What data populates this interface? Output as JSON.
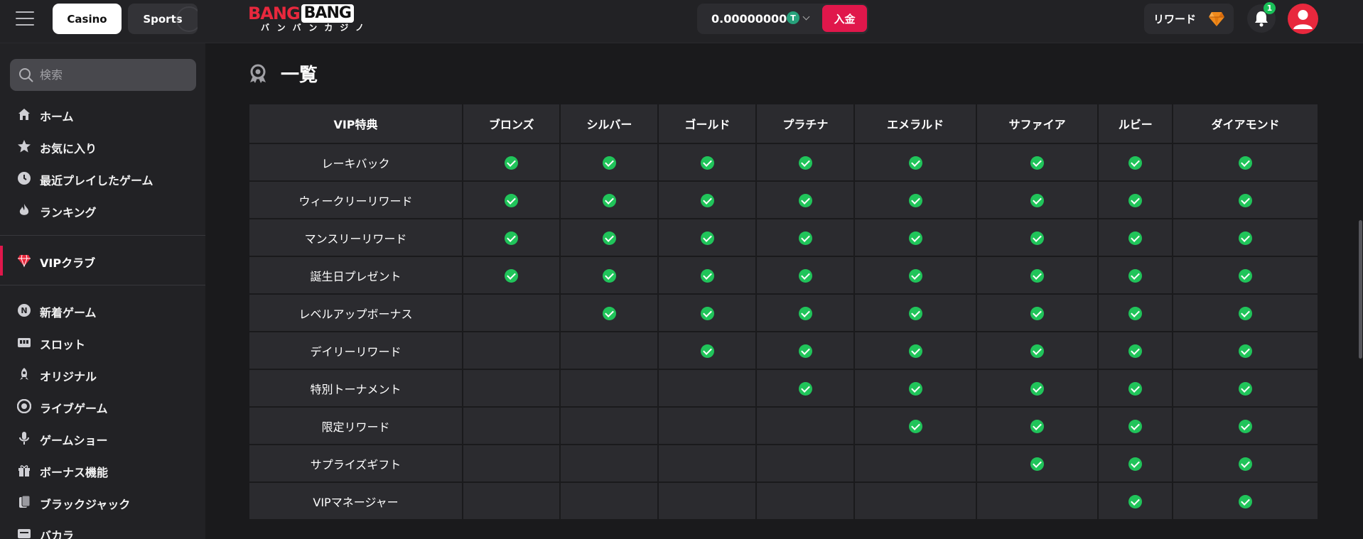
{
  "topbar": {
    "tabs": [
      {
        "label": "Casino"
      },
      {
        "label": "Sports"
      }
    ],
    "logo": {
      "word1": "BANG",
      "word2": "BANG",
      "kana": "バンバンカジノ"
    },
    "wallet": {
      "amount": "0.00000000",
      "currency_symbol": "T",
      "currency_color": "#26a17b"
    },
    "deposit_label": "入金",
    "reward_label": "リワード",
    "notification_count": "1"
  },
  "sidebar": {
    "search_placeholder": "検索",
    "group1": [
      {
        "label": "ホーム",
        "icon": "home-icon"
      },
      {
        "label": "お気に入り",
        "icon": "star-icon"
      },
      {
        "label": "最近プレイしたゲーム",
        "icon": "clock-icon"
      },
      {
        "label": "ランキング",
        "icon": "flame-icon"
      }
    ],
    "vip": {
      "label": "VIPクラブ",
      "icon": "diamond-icon"
    },
    "group2": [
      {
        "label": "新着ゲーム",
        "icon": "new-badge-icon"
      },
      {
        "label": "スロット",
        "icon": "slot-machine-icon"
      },
      {
        "label": "オリジナル",
        "icon": "rocket-icon"
      },
      {
        "label": "ライブゲーム",
        "icon": "chip-icon"
      },
      {
        "label": "ゲームショー",
        "icon": "microphone-icon"
      },
      {
        "label": "ボーナス機能",
        "icon": "gift-icon"
      },
      {
        "label": "ブラックジャック",
        "icon": "cards-icon"
      },
      {
        "label": "バカラ",
        "icon": "baccarat-icon"
      }
    ]
  },
  "main": {
    "section_title": "一覧",
    "table": {
      "headers": [
        "VIP特典",
        "ブロンズ",
        "シルバー",
        "ゴールド",
        "プラチナ",
        "エメラルド",
        "サファイア",
        "ルビー",
        "ダイアモンド"
      ],
      "rows": [
        {
          "label": "レーキバック",
          "checks": [
            1,
            1,
            1,
            1,
            1,
            1,
            1,
            1
          ]
        },
        {
          "label": "ウィークリーリワード",
          "checks": [
            1,
            1,
            1,
            1,
            1,
            1,
            1,
            1
          ]
        },
        {
          "label": "マンスリーリワード",
          "checks": [
            1,
            1,
            1,
            1,
            1,
            1,
            1,
            1
          ]
        },
        {
          "label": "誕生日プレゼント",
          "checks": [
            1,
            1,
            1,
            1,
            1,
            1,
            1,
            1
          ]
        },
        {
          "label": "レベルアップボーナス",
          "checks": [
            0,
            1,
            1,
            1,
            1,
            1,
            1,
            1
          ]
        },
        {
          "label": "デイリーリワード",
          "checks": [
            0,
            0,
            1,
            1,
            1,
            1,
            1,
            1
          ]
        },
        {
          "label": "特別トーナメント",
          "checks": [
            0,
            0,
            0,
            1,
            1,
            1,
            1,
            1
          ]
        },
        {
          "label": "限定リワード",
          "checks": [
            0,
            0,
            0,
            0,
            1,
            1,
            1,
            1
          ]
        },
        {
          "label": "サプライズギフト",
          "checks": [
            0,
            0,
            0,
            0,
            0,
            1,
            1,
            1
          ]
        },
        {
          "label": "VIPマネージャー",
          "checks": [
            0,
            0,
            0,
            0,
            0,
            0,
            1,
            1
          ]
        }
      ]
    }
  },
  "colors": {
    "accent": "#e0174b",
    "check": "#20c45a",
    "brand_red": "#e8283d"
  }
}
